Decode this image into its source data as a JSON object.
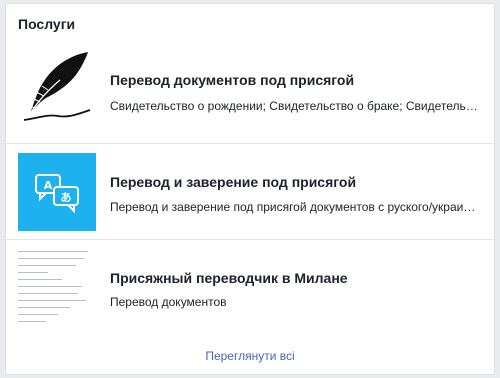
{
  "services": {
    "title": "Послуги",
    "items": [
      {
        "title": "Перевод документов под присягой",
        "subtitle": "Свидетельство о рождении; Свидетельство о браке; Свидетельство о смерти",
        "thumb_icon": "quill-feather-icon"
      },
      {
        "title": "Перевод и заверение под присягой",
        "subtitle": "Перевод и заверение под присягой документов с руского/украинского языка",
        "thumb_icon": "translate-chat-icon",
        "thumb_color": "#1eb1f0"
      },
      {
        "title": "Присяжный переводчик в Милане",
        "subtitle": "Перевод документов",
        "thumb_icon": "document-preview-icon"
      }
    ],
    "see_all": "Переглянути всі"
  },
  "colors": {
    "link": "#4267b2",
    "accent": "#1eb1f0",
    "text": "#1d2129"
  }
}
